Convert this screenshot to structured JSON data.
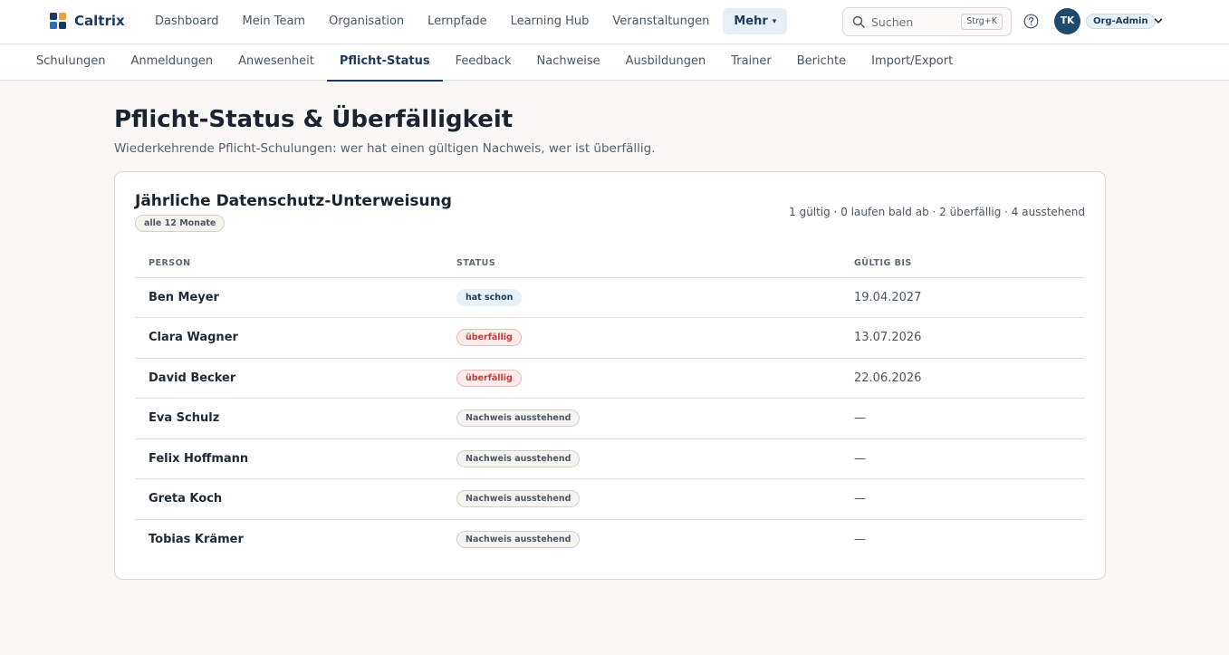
{
  "app": {
    "name": "Caltrix"
  },
  "topnav": {
    "items": [
      "Dashboard",
      "Mein Team",
      "Organisation",
      "Lernpfade",
      "Learning Hub",
      "Veranstaltungen"
    ],
    "more_label": "Mehr"
  },
  "search": {
    "placeholder": "Suchen",
    "shortcut": "Strg+K"
  },
  "user": {
    "initials": "TK",
    "role": "Org-Admin"
  },
  "subnav": {
    "tabs": [
      "Schulungen",
      "Anmeldungen",
      "Anwesenheit",
      "Pflicht-Status",
      "Feedback",
      "Nachweise",
      "Ausbildungen",
      "Trainer",
      "Berichte",
      "Import/Export"
    ],
    "active": "Pflicht-Status"
  },
  "page": {
    "title": "Pflicht-Status & Überfälligkeit",
    "subtitle": "Wiederkehrende Pflicht-Schulungen: wer hat einen gültigen Nachweis, wer ist überfällig."
  },
  "card": {
    "title": "Jährliche Datenschutz-Unterweisung",
    "frequency": "alle 12 Monate",
    "summary": "1 gültig · 0 laufen bald ab · 2 überfällig · 4 ausstehend",
    "columns": [
      "PERSON",
      "STATUS",
      "GÜLTIG BIS"
    ],
    "rows": [
      {
        "person": "Ben Meyer",
        "status": "hat schon",
        "status_type": "valid",
        "valid_until": "19.04.2027"
      },
      {
        "person": "Clara Wagner",
        "status": "überfällig",
        "status_type": "overdue",
        "valid_until": "13.07.2026"
      },
      {
        "person": "David Becker",
        "status": "überfällig",
        "status_type": "overdue",
        "valid_until": "22.06.2026"
      },
      {
        "person": "Eva Schulz",
        "status": "Nachweis ausstehend",
        "status_type": "pending",
        "valid_until": "—"
      },
      {
        "person": "Felix Hoffmann",
        "status": "Nachweis ausstehend",
        "status_type": "pending",
        "valid_until": "—"
      },
      {
        "person": "Greta Koch",
        "status": "Nachweis ausstehend",
        "status_type": "pending",
        "valid_until": "—"
      },
      {
        "person": "Tobias Krämer",
        "status": "Nachweis ausstehend",
        "status_type": "pending",
        "valid_until": "—"
      }
    ]
  },
  "icons": {
    "logo": "caltrix-logo-icon",
    "search": "search-icon",
    "help": "help-icon",
    "dropdown": "chevron-down-icon"
  },
  "colors": {
    "brand": "#1e3a5f",
    "overdue": "#c23b3b",
    "valid_bg": "#e8f0f8",
    "pending_bg": "#f6f4f1"
  }
}
